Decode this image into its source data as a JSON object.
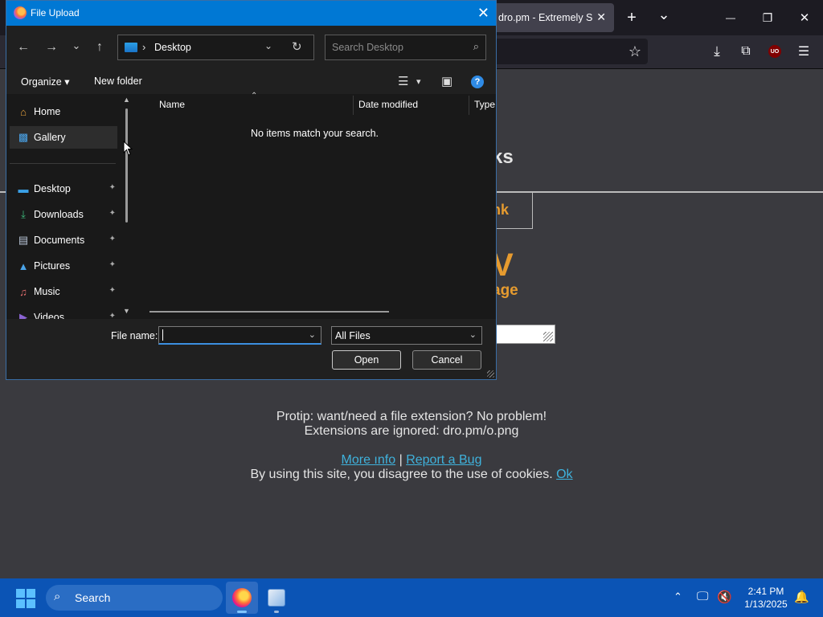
{
  "browser": {
    "tab_title": "dro.pm - Extremely Sh",
    "tab_close": "✕",
    "new_tab": "+",
    "tab_list": "⌄",
    "minimize": "—",
    "restore": "❐",
    "close": "✕",
    "bookmark_star": "☆",
    "downloads": "⤓",
    "extensions": "⧉",
    "ublock_label": "UO",
    "menu": "☰"
  },
  "page": {
    "heading_fragment": "ks",
    "shortlink_fragment": "nk",
    "big_letter": "V",
    "age_fragment": "age",
    "protip_line1": "Protip: want/need a file extension? No problem!",
    "protip_line2": "Extensions are ignored: dro.pm/o.png",
    "more_info": "More ınfo",
    "separator": "|",
    "report_bug": "Report a Bug",
    "cookie_text": "By using this site, you disagree to the use of cookies.",
    "cookie_ok": "Ok"
  },
  "dialog": {
    "title": "File Upload",
    "close": "✕",
    "back": "←",
    "forward": "→",
    "recent": "⌄",
    "up": "↑",
    "address_separator": "›",
    "address_location": "Desktop",
    "address_dropdown": "⌄",
    "refresh": "↻",
    "search_placeholder": "Search Desktop",
    "search_icon": "⌕",
    "organize": "Organize ▾",
    "new_folder": "New folder",
    "view_icon": "☰",
    "view_dropdown": "▾",
    "preview_pane_icon": "▣",
    "help": "?",
    "nav_items": [
      {
        "label": "Home",
        "icon": "home-icon",
        "glyph": "⌂",
        "color": "#e8a23c",
        "pinned": false
      },
      {
        "label": "Gallery",
        "icon": "gallery-icon",
        "glyph": "▩",
        "color": "#4aa3e8",
        "pinned": false
      },
      {
        "label": "Desktop",
        "icon": "desktop-icon",
        "glyph": "▬",
        "color": "#3aa0e6",
        "pinned": true
      },
      {
        "label": "Downloads",
        "icon": "downloads-icon",
        "glyph": "⤓",
        "color": "#3fbf7f",
        "pinned": true
      },
      {
        "label": "Documents",
        "icon": "documents-icon",
        "glyph": "▤",
        "color": "#b8c4d6",
        "pinned": true
      },
      {
        "label": "Pictures",
        "icon": "pictures-icon",
        "glyph": "▲",
        "color": "#4aa3e8",
        "pinned": true
      },
      {
        "label": "Music",
        "icon": "music-icon",
        "glyph": "♫",
        "color": "#e36d6d",
        "pinned": true
      },
      {
        "label": "Videos",
        "icon": "videos-icon",
        "glyph": "▶",
        "color": "#8a63d2",
        "pinned": true
      }
    ],
    "pin_glyph": "📌",
    "columns": [
      "Name",
      "Date modified",
      "Type"
    ],
    "sort_caret": "⌃",
    "empty_message": "No items match your search.",
    "file_name_label": "File name:",
    "file_name_value": "",
    "file_type": "All Files",
    "dropdown_glyph": "⌄",
    "open_button": "Open",
    "cancel_button": "Cancel"
  },
  "taskbar": {
    "search_label": "Search",
    "search_icon": "⌕",
    "tray_chevron": "⌃",
    "network_icon": "🖵",
    "volume_icon": "🔇",
    "time": "2:41 PM",
    "date": "1/13/2025",
    "notification_icon": "🔔"
  }
}
